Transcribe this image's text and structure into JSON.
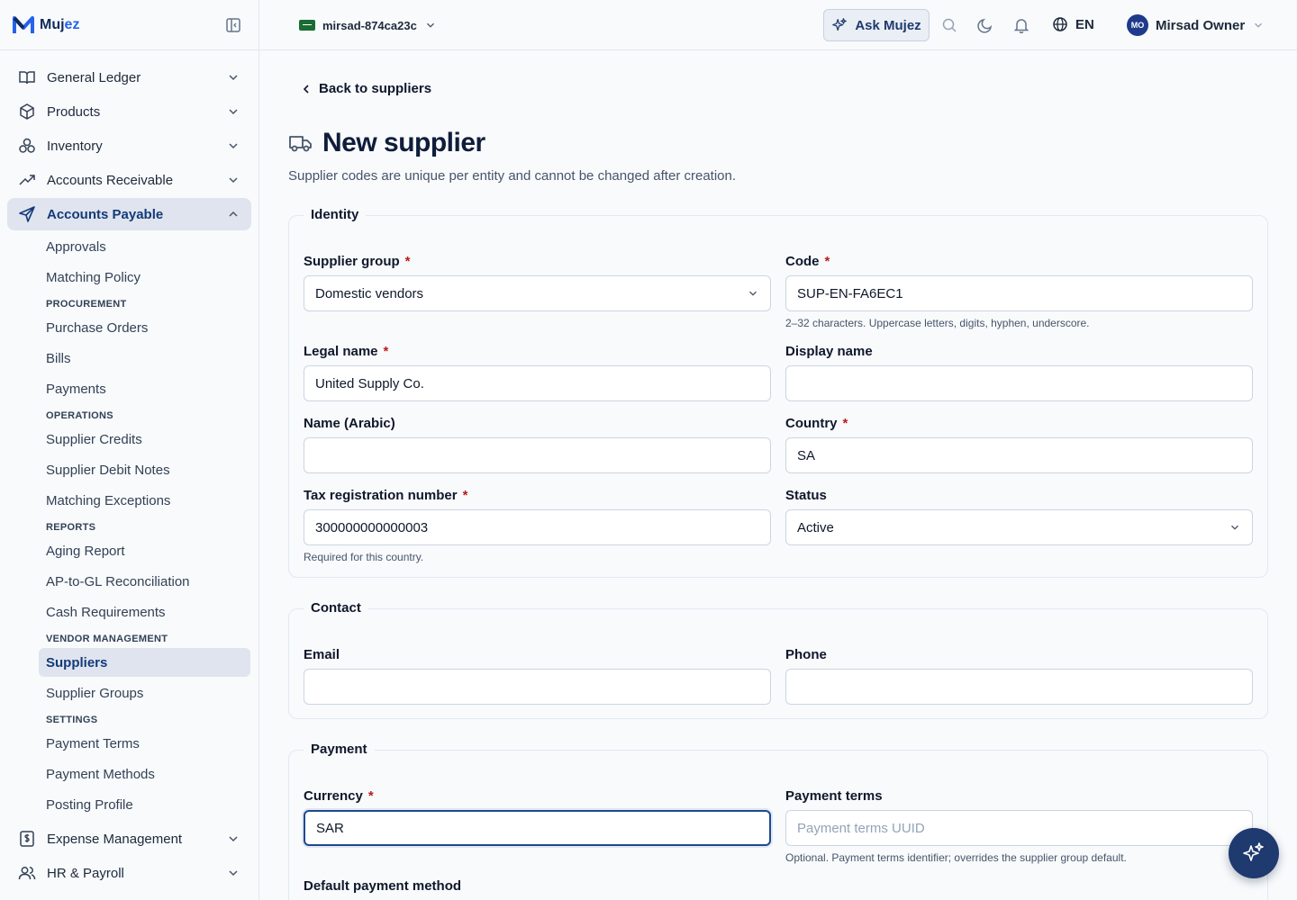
{
  "brand": {
    "name_prefix": "Muj",
    "name_suffix": "ez"
  },
  "topbar": {
    "entity": "mirsad-874ca23c",
    "ask_label": "Ask Mujez",
    "language": "EN",
    "user_initials": "MO",
    "user_name": "Mirsad Owner"
  },
  "sidebar": {
    "top_items": [
      {
        "label": "General Ledger",
        "icon": "book-icon"
      },
      {
        "label": "Products",
        "icon": "box-icon"
      },
      {
        "label": "Inventory",
        "icon": "boxes-icon"
      },
      {
        "label": "Accounts Receivable",
        "icon": "trend-up-icon"
      }
    ],
    "active_section": {
      "label": "Accounts Payable",
      "icon": "send-icon"
    },
    "sub": {
      "approvals": "Approvals",
      "matching_policy": "Matching Policy",
      "h_procurement": "PROCUREMENT",
      "purchase_orders": "Purchase Orders",
      "bills": "Bills",
      "payments": "Payments",
      "h_operations": "OPERATIONS",
      "supplier_credits": "Supplier Credits",
      "supplier_debit_notes": "Supplier Debit Notes",
      "matching_exceptions": "Matching Exceptions",
      "h_reports": "REPORTS",
      "aging_report": "Aging Report",
      "ap_gl": "AP-to-GL Reconciliation",
      "cash_req": "Cash Requirements",
      "h_vendor": "VENDOR MANAGEMENT",
      "suppliers": "Suppliers",
      "supplier_groups": "Supplier Groups",
      "h_settings": "SETTINGS",
      "payment_terms": "Payment Terms",
      "payment_methods": "Payment Methods",
      "posting_profile": "Posting Profile"
    },
    "bottom_items": [
      {
        "label": "Expense Management",
        "icon": "receipt-icon"
      },
      {
        "label": "HR & Payroll",
        "icon": "users-icon"
      }
    ]
  },
  "page": {
    "back_label": "Back to suppliers",
    "title": "New supplier",
    "subtitle": "Supplier codes are unique per entity and cannot be changed after creation."
  },
  "identity": {
    "legend": "Identity",
    "supplier_group_label": "Supplier group",
    "supplier_group_value": "Domestic vendors",
    "code_label": "Code",
    "code_value": "SUP-EN-FA6EC1",
    "code_help": "2–32 characters. Uppercase letters, digits, hyphen, underscore.",
    "legal_name_label": "Legal name",
    "legal_name_value": "United Supply Co.",
    "display_name_label": "Display name",
    "display_name_value": "",
    "name_ar_label": "Name (Arabic)",
    "name_ar_value": "",
    "country_label": "Country",
    "country_value": "SA",
    "trn_label": "Tax registration number",
    "trn_value": "300000000000003",
    "trn_help": "Required for this country.",
    "status_label": "Status",
    "status_value": "Active"
  },
  "contact": {
    "legend": "Contact",
    "email_label": "Email",
    "email_value": "",
    "phone_label": "Phone",
    "phone_value": ""
  },
  "payment": {
    "legend": "Payment",
    "currency_label": "Currency",
    "currency_value": "SAR",
    "terms_label": "Payment terms",
    "terms_placeholder": "Payment terms UUID",
    "terms_help": "Optional. Payment terms identifier; overrides the supplier group default.",
    "method_label": "Default payment method"
  },
  "required_mark": "*"
}
